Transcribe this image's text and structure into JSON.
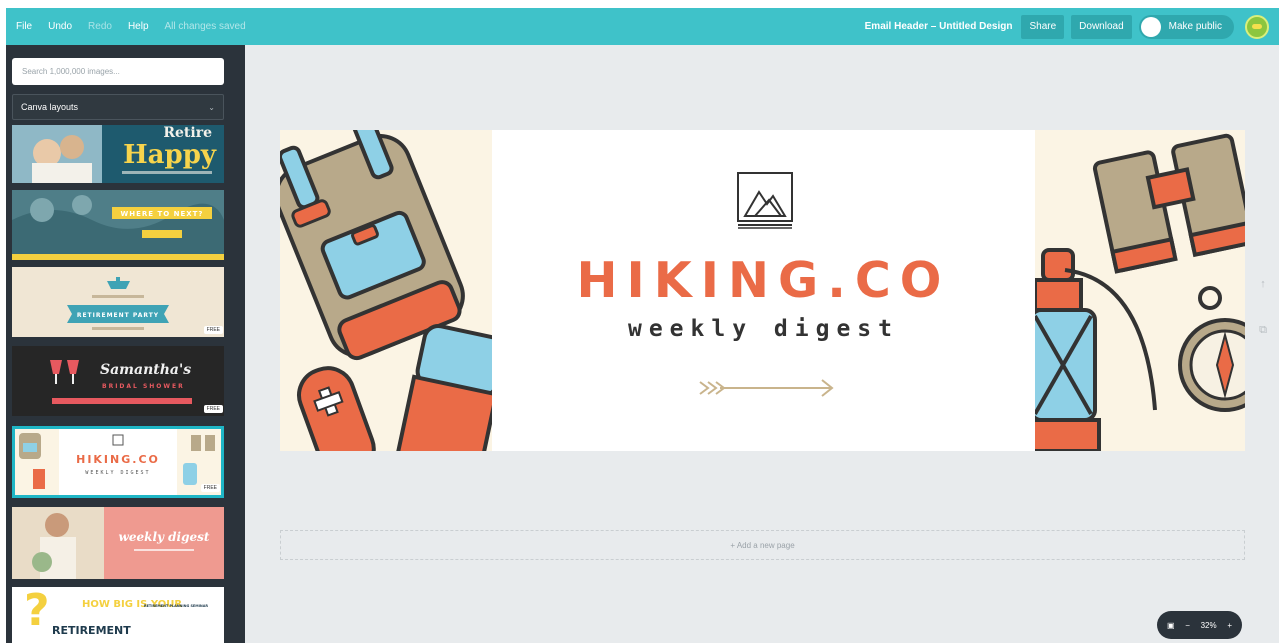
{
  "topbar": {
    "menu": {
      "file": "File",
      "undo": "Undo",
      "redo": "Redo",
      "help": "Help",
      "saved_status": "All changes saved"
    },
    "document_title": "Email Header – Untitled Design",
    "share_label": "Share",
    "download_label": "Download",
    "make_public_label": "Make public"
  },
  "sidebar": {
    "search_placeholder": "Search 1,000,000 images...",
    "layout_dropdown": "Canva layouts",
    "thumbnails": [
      {
        "line1": "Retire",
        "line2": "Happy"
      },
      {
        "line1": "WHERE TO NEXT?"
      },
      {
        "line1": "RETIREMENT PARTY",
        "badge": "FREE"
      },
      {
        "line1": "Samantha's",
        "line2": "BRIDAL SHOWER",
        "badge": "FREE"
      },
      {
        "line1": "HIKING.CO",
        "line2": "WEEKLY DIGEST",
        "badge": "FREE",
        "selected": true
      },
      {
        "line1": "weekly digest"
      },
      {
        "line1": "HOW BIG IS YOUR",
        "line2": "RETIREMENT",
        "line3": "RETIREMENT PLANNING SEMINAR"
      }
    ]
  },
  "canvas": {
    "brand": "HIKING.CO",
    "subtitle": "weekly digest",
    "add_page_label": "+ Add a new page",
    "zoom_value": "32%"
  },
  "colors": {
    "topbar": "#3fc2c9",
    "sidebar": "#2b333b",
    "workspace": "#e8ebed",
    "accent_orange": "#ea6b47",
    "accent_blue": "#8ed0e6",
    "backpack": "#b8a98a",
    "cream": "#fbf4e4"
  },
  "icons": [
    "avatar",
    "mountain-logo-icon",
    "arrow-icon",
    "backpack-icon",
    "knife-icon",
    "thermos-icon",
    "binoculars-icon",
    "lantern-icon",
    "compass-icon",
    "present-icon",
    "copy-icon"
  ]
}
